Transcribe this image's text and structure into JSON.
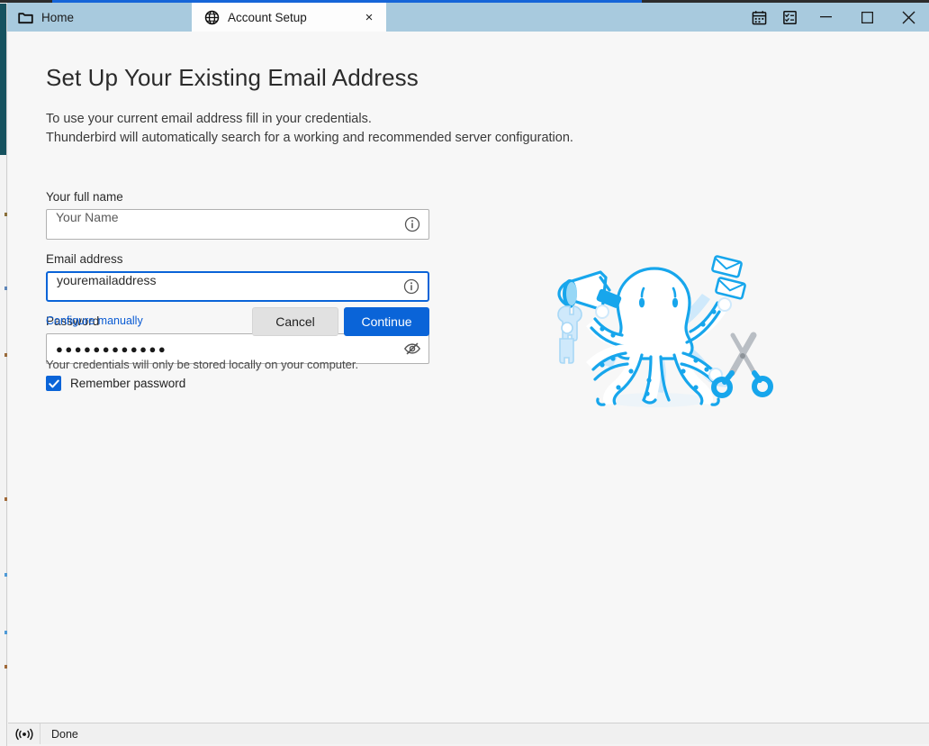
{
  "window": {
    "tabs": [
      {
        "label": "Home",
        "icon": "folder-icon",
        "active": false
      },
      {
        "label": "Account Setup",
        "icon": "globe-icon",
        "active": true,
        "close": "×"
      }
    ],
    "toolbar_icons": [
      {
        "name": "calendar-icon"
      },
      {
        "name": "tasks-icon"
      }
    ],
    "controls": {
      "minimize": "—",
      "maximize": "□",
      "close": "✕"
    }
  },
  "page": {
    "title": "Set Up Your Existing Email Address",
    "subtitle_line1": "To use your current email address fill in your credentials.",
    "subtitle_line2": "Thunderbird will automatically search for a working and recommended server configuration.",
    "footnote": "Your credentials will only be stored locally on your computer."
  },
  "form": {
    "fullname": {
      "label": "Your full name",
      "value": "Your Name",
      "placeholder": "Your Name",
      "is_placeholder": true,
      "affordance_icon": "info-icon",
      "focused": false
    },
    "email": {
      "label": "Email address",
      "value": "youremailaddress",
      "placeholder": "Email address",
      "is_placeholder": false,
      "affordance_icon": "info-icon",
      "focused": true
    },
    "password": {
      "label": "Password",
      "value": "●●●●●●●●●●●●",
      "placeholder": "Password",
      "affordance_icon": "eye-slash-icon",
      "focused": false
    },
    "remember": {
      "label": "Remember password",
      "checked": true
    }
  },
  "actions": {
    "configure_manually": "Configure manually",
    "cancel": "Cancel",
    "continue": "Continue"
  },
  "illustration": {
    "name": "thunderbird-octopus-illustration",
    "items": [
      "megaphone",
      "wrench",
      "envelopes",
      "scissors"
    ]
  },
  "statusbar": {
    "icon": "broadcast-icon",
    "text": "Done"
  },
  "colors": {
    "accent_blue": "#0a64d8",
    "tabbar_blue": "#a8cade",
    "link_blue": "#0a5bd3",
    "illustration_blue": "#1eaaf0",
    "background": "#f7f7f7"
  }
}
